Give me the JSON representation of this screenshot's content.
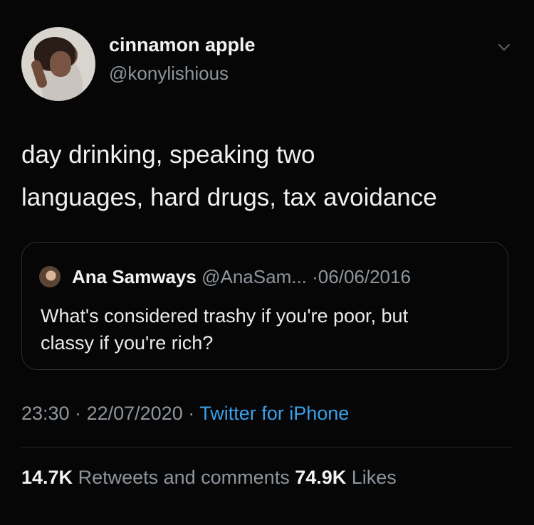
{
  "tweet": {
    "author": {
      "display_name": "cinnamon apple",
      "handle": "@konylishious"
    },
    "text_line1": "day drinking, speaking two",
    "text_line2": "languages, hard drugs, tax avoidance",
    "quoted": {
      "display_name": "Ana Samways",
      "handle": "@AnaSam...",
      "separator": " ·",
      "date": "06/06/2016",
      "text_line1": "What's considered trashy if you're poor, but",
      "text_line2": "classy if you're rich?"
    },
    "time": "23:30",
    "date": "22/07/2020",
    "dot": " · ",
    "source": "Twitter for iPhone",
    "stats": {
      "retweets_count": "14.7K",
      "retweets_label": " Retweets and comments ",
      "likes_count": "74.9K",
      "likes_label": " Likes"
    },
    "menu_icon": "chevron-down-icon",
    "colors": {
      "background": "#060606",
      "link": "#3aa0ea",
      "secondary_text": "#8e959c"
    }
  }
}
